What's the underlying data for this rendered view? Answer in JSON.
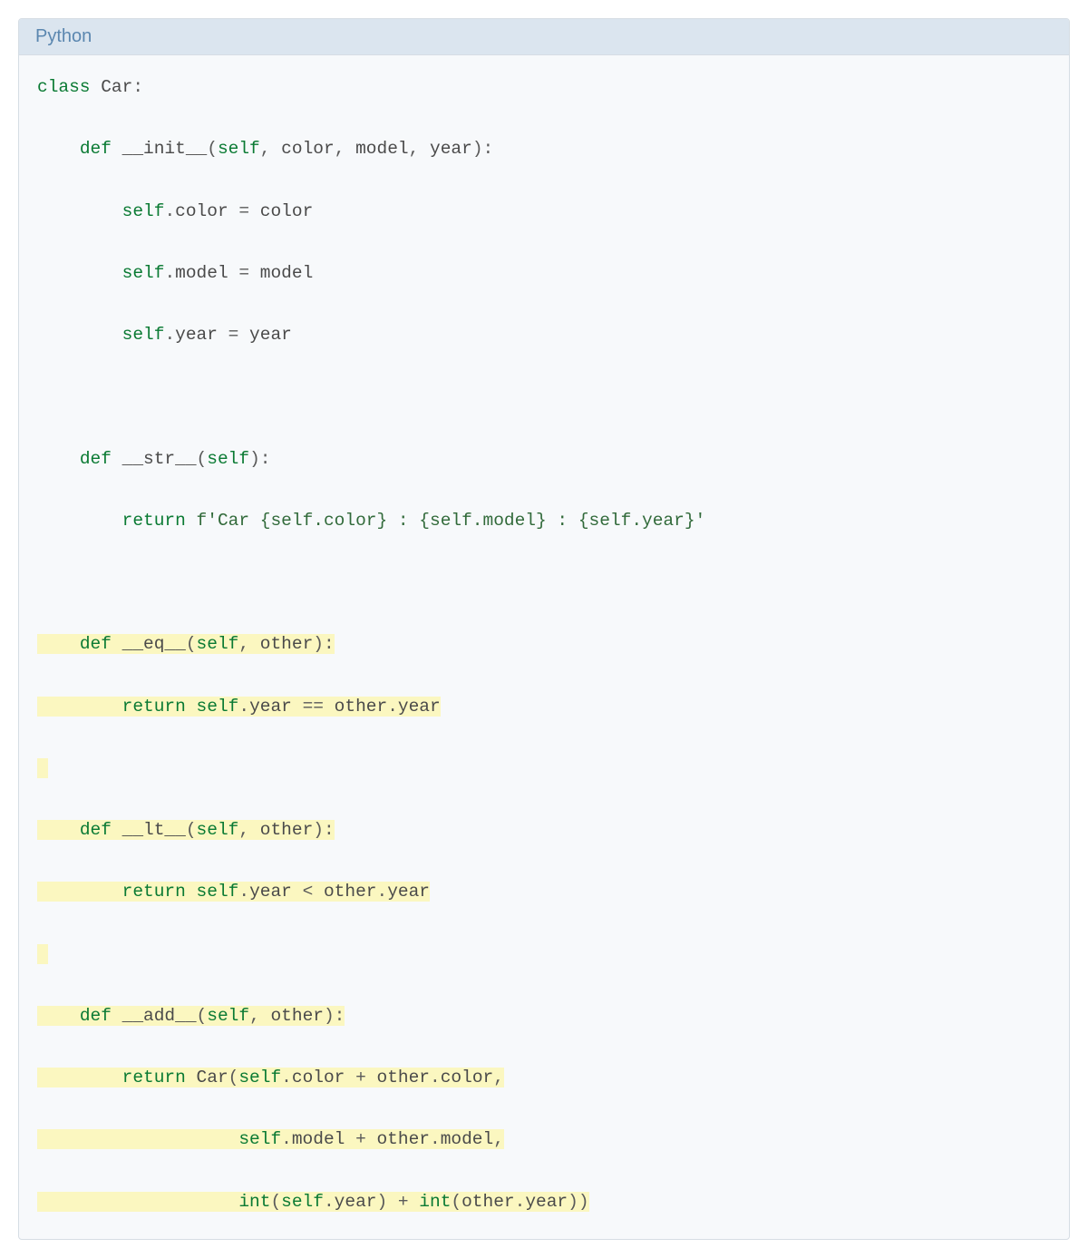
{
  "header": {
    "language": "Python"
  },
  "colors": {
    "keyword": "#0a7a33",
    "builtin": "#0a7a33",
    "text": "#4a4a4a",
    "string": "#316a3a",
    "highlight_bg": "#fbf7c0",
    "header_bg": "#dbe5ef",
    "header_text": "#5b87b0",
    "body_bg": "#f7f9fb"
  },
  "code": {
    "lines": [
      {
        "hl": false,
        "tokens": [
          {
            "t": "class",
            "c": "kw"
          },
          {
            "t": " ",
            "c": "ws"
          },
          {
            "t": "Car",
            "c": "name"
          },
          {
            "t": ":",
            "c": "punc"
          }
        ]
      },
      {
        "hl": false,
        "tokens": [
          {
            "t": "    ",
            "c": "ws"
          },
          {
            "t": "def",
            "c": "kw"
          },
          {
            "t": " ",
            "c": "ws"
          },
          {
            "t": "__init__",
            "c": "name"
          },
          {
            "t": "(",
            "c": "punc"
          },
          {
            "t": "self",
            "c": "builtin"
          },
          {
            "t": ", ",
            "c": "punc"
          },
          {
            "t": "color",
            "c": "name"
          },
          {
            "t": ", ",
            "c": "punc"
          },
          {
            "t": "model",
            "c": "name"
          },
          {
            "t": ", ",
            "c": "punc"
          },
          {
            "t": "year",
            "c": "name"
          },
          {
            "t": "):",
            "c": "punc"
          }
        ]
      },
      {
        "hl": false,
        "tokens": [
          {
            "t": "        ",
            "c": "ws"
          },
          {
            "t": "self",
            "c": "builtin"
          },
          {
            "t": ".",
            "c": "punc"
          },
          {
            "t": "color ",
            "c": "name"
          },
          {
            "t": "=",
            "c": "op"
          },
          {
            "t": " color",
            "c": "name"
          }
        ]
      },
      {
        "hl": false,
        "tokens": [
          {
            "t": "        ",
            "c": "ws"
          },
          {
            "t": "self",
            "c": "builtin"
          },
          {
            "t": ".",
            "c": "punc"
          },
          {
            "t": "model ",
            "c": "name"
          },
          {
            "t": "=",
            "c": "op"
          },
          {
            "t": " model",
            "c": "name"
          }
        ]
      },
      {
        "hl": false,
        "tokens": [
          {
            "t": "        ",
            "c": "ws"
          },
          {
            "t": "self",
            "c": "builtin"
          },
          {
            "t": ".",
            "c": "punc"
          },
          {
            "t": "year ",
            "c": "name"
          },
          {
            "t": "=",
            "c": "op"
          },
          {
            "t": " year",
            "c": "name"
          }
        ]
      },
      {
        "hl": false,
        "tokens": [
          {
            "t": "",
            "c": "ws"
          }
        ]
      },
      {
        "hl": false,
        "tokens": [
          {
            "t": "    ",
            "c": "ws"
          },
          {
            "t": "def",
            "c": "kw"
          },
          {
            "t": " ",
            "c": "ws"
          },
          {
            "t": "__str__",
            "c": "name"
          },
          {
            "t": "(",
            "c": "punc"
          },
          {
            "t": "self",
            "c": "builtin"
          },
          {
            "t": "):",
            "c": "punc"
          }
        ]
      },
      {
        "hl": false,
        "tokens": [
          {
            "t": "        ",
            "c": "ws"
          },
          {
            "t": "return",
            "c": "kw"
          },
          {
            "t": " ",
            "c": "ws"
          },
          {
            "t": "f'Car {self.color} : {self.model} : {self.year}'",
            "c": "str"
          }
        ]
      },
      {
        "hl": false,
        "tokens": [
          {
            "t": "",
            "c": "ws"
          }
        ]
      },
      {
        "hl": true,
        "tokens": [
          {
            "t": "    ",
            "c": "ws"
          },
          {
            "t": "def",
            "c": "kw"
          },
          {
            "t": " ",
            "c": "ws"
          },
          {
            "t": "__eq__",
            "c": "name"
          },
          {
            "t": "(",
            "c": "punc"
          },
          {
            "t": "self",
            "c": "builtin"
          },
          {
            "t": ", ",
            "c": "punc"
          },
          {
            "t": "other",
            "c": "name"
          },
          {
            "t": "):",
            "c": "punc"
          }
        ]
      },
      {
        "hl": true,
        "tokens": [
          {
            "t": "        ",
            "c": "ws"
          },
          {
            "t": "return",
            "c": "kw"
          },
          {
            "t": " ",
            "c": "ws"
          },
          {
            "t": "self",
            "c": "builtin"
          },
          {
            "t": ".",
            "c": "punc"
          },
          {
            "t": "year ",
            "c": "name"
          },
          {
            "t": "==",
            "c": "op"
          },
          {
            "t": " other",
            "c": "name"
          },
          {
            "t": ".",
            "c": "punc"
          },
          {
            "t": "year",
            "c": "name"
          }
        ]
      },
      {
        "hl": true,
        "tokens": [
          {
            "t": "",
            "c": "ws"
          }
        ]
      },
      {
        "hl": true,
        "tokens": [
          {
            "t": "    ",
            "c": "ws"
          },
          {
            "t": "def",
            "c": "kw"
          },
          {
            "t": " ",
            "c": "ws"
          },
          {
            "t": "__lt__",
            "c": "name"
          },
          {
            "t": "(",
            "c": "punc"
          },
          {
            "t": "self",
            "c": "builtin"
          },
          {
            "t": ", ",
            "c": "punc"
          },
          {
            "t": "other",
            "c": "name"
          },
          {
            "t": "):",
            "c": "punc"
          }
        ]
      },
      {
        "hl": true,
        "tokens": [
          {
            "t": "        ",
            "c": "ws"
          },
          {
            "t": "return",
            "c": "kw"
          },
          {
            "t": " ",
            "c": "ws"
          },
          {
            "t": "self",
            "c": "builtin"
          },
          {
            "t": ".",
            "c": "punc"
          },
          {
            "t": "year ",
            "c": "name"
          },
          {
            "t": "<",
            "c": "op"
          },
          {
            "t": " other",
            "c": "name"
          },
          {
            "t": ".",
            "c": "punc"
          },
          {
            "t": "year",
            "c": "name"
          }
        ]
      },
      {
        "hl": true,
        "tokens": [
          {
            "t": "",
            "c": "ws"
          }
        ]
      },
      {
        "hl": true,
        "tokens": [
          {
            "t": "    ",
            "c": "ws"
          },
          {
            "t": "def",
            "c": "kw"
          },
          {
            "t": " ",
            "c": "ws"
          },
          {
            "t": "__add__",
            "c": "name"
          },
          {
            "t": "(",
            "c": "punc"
          },
          {
            "t": "self",
            "c": "builtin"
          },
          {
            "t": ", ",
            "c": "punc"
          },
          {
            "t": "other",
            "c": "name"
          },
          {
            "t": "):",
            "c": "punc"
          }
        ]
      },
      {
        "hl": true,
        "tokens": [
          {
            "t": "        ",
            "c": "ws"
          },
          {
            "t": "return",
            "c": "kw"
          },
          {
            "t": " ",
            "c": "ws"
          },
          {
            "t": "Car",
            "c": "name"
          },
          {
            "t": "(",
            "c": "punc"
          },
          {
            "t": "self",
            "c": "builtin"
          },
          {
            "t": ".",
            "c": "punc"
          },
          {
            "t": "color ",
            "c": "name"
          },
          {
            "t": "+",
            "c": "op"
          },
          {
            "t": " other",
            "c": "name"
          },
          {
            "t": ".",
            "c": "punc"
          },
          {
            "t": "color",
            "c": "name"
          },
          {
            "t": ",",
            "c": "punc"
          }
        ]
      },
      {
        "hl": true,
        "tokens": [
          {
            "t": "                   ",
            "c": "ws"
          },
          {
            "t": "self",
            "c": "builtin"
          },
          {
            "t": ".",
            "c": "punc"
          },
          {
            "t": "model ",
            "c": "name"
          },
          {
            "t": "+",
            "c": "op"
          },
          {
            "t": " other",
            "c": "name"
          },
          {
            "t": ".",
            "c": "punc"
          },
          {
            "t": "model",
            "c": "name"
          },
          {
            "t": ",",
            "c": "punc"
          }
        ]
      },
      {
        "hl": true,
        "tokens": [
          {
            "t": "                   ",
            "c": "ws"
          },
          {
            "t": "int",
            "c": "builtin"
          },
          {
            "t": "(",
            "c": "punc"
          },
          {
            "t": "self",
            "c": "builtin"
          },
          {
            "t": ".",
            "c": "punc"
          },
          {
            "t": "year",
            "c": "name"
          },
          {
            "t": ") ",
            "c": "punc"
          },
          {
            "t": "+",
            "c": "op"
          },
          {
            "t": " ",
            "c": "ws"
          },
          {
            "t": "int",
            "c": "builtin"
          },
          {
            "t": "(",
            "c": "punc"
          },
          {
            "t": "other",
            "c": "name"
          },
          {
            "t": ".",
            "c": "punc"
          },
          {
            "t": "year",
            "c": "name"
          },
          {
            "t": "))",
            "c": "punc"
          }
        ]
      }
    ]
  }
}
